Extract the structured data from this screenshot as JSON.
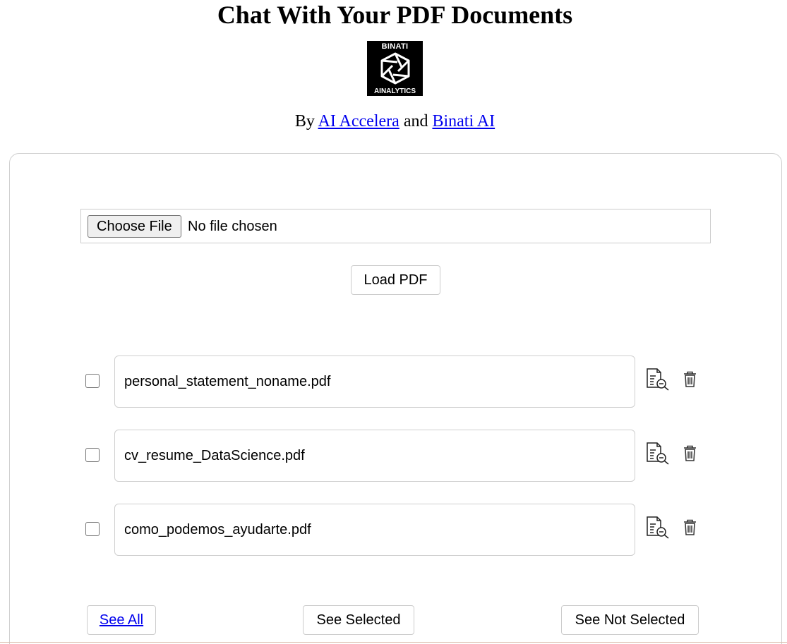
{
  "header": {
    "title": "Chat With Your PDF Documents",
    "logo": {
      "text_top": "BINATI",
      "text_bottom": "AINALYTICS",
      "icon": "aperture-logo-icon"
    },
    "byline": {
      "prefix": "By",
      "link1": "AI Accelera",
      "conjunction": "and",
      "link2": "Binati AI"
    }
  },
  "upload": {
    "choose_button": "Choose File",
    "file_status": "No file chosen",
    "load_button": "Load PDF"
  },
  "documents": [
    {
      "name": "personal_statement_noname.pdf",
      "checked": false
    },
    {
      "name": "cv_resume_DataScience.pdf",
      "checked": false
    },
    {
      "name": "como_podemos_ayudarte.pdf",
      "checked": false
    }
  ],
  "row_icons": {
    "view": "document-search-icon",
    "delete": "trash-icon"
  },
  "filters": {
    "see_all": "See All",
    "see_selected": "See Selected",
    "see_not_selected": "See Not Selected"
  },
  "colors": {
    "link": "#0000ee",
    "border": "#cccccc",
    "text": "#000000"
  }
}
